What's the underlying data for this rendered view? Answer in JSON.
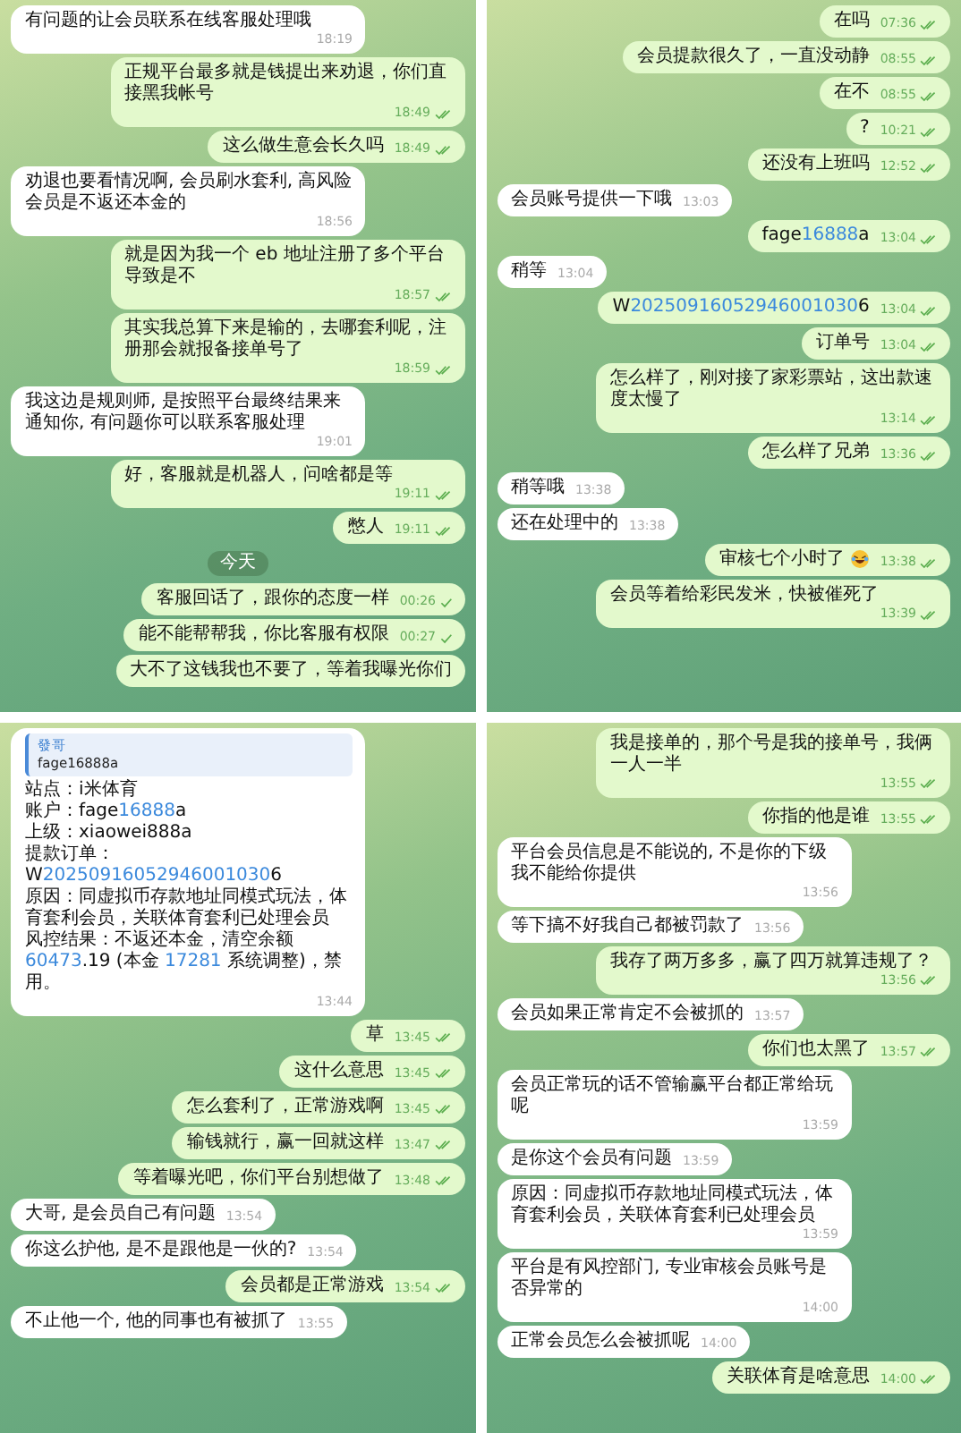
{
  "panels": [
    {
      "items": [
        {
          "kind": "in",
          "text": "有问题的让会员联系在线客服处理哦",
          "time": "18:19"
        },
        {
          "kind": "out",
          "text": "正规平台最多就是钱提出来劝退，你们直接黑我帐号",
          "time": "18:49",
          "read": true
        },
        {
          "kind": "out",
          "text": "这么做生意会长久吗",
          "time": "18:49",
          "read": true
        },
        {
          "kind": "in",
          "text": "劝退也要看情况啊, 会员刷水套利, 高风险会员是不返还本金的",
          "time": "18:56"
        },
        {
          "kind": "out",
          "text": "就是因为我一个 eb 地址注册了多个平台导致是不",
          "time": "18:57",
          "read": true
        },
        {
          "kind": "out",
          "text": "其实我总算下来是输的，去哪套利呢，注册那会就报备接单号了",
          "time": "18:59",
          "read": true
        },
        {
          "kind": "in",
          "text": "我这边是规则师, 是按照平台最终结果来通知你, 有问题你可以联系客服处理",
          "time": "19:01"
        },
        {
          "kind": "out",
          "text": "好，客服就是机器人，问啥都是等",
          "time": "19:11",
          "read": true
        },
        {
          "kind": "out",
          "text": "憋人",
          "time": "19:11",
          "read": true
        },
        {
          "kind": "date",
          "text": "今天"
        },
        {
          "kind": "out",
          "text": "客服回话了，跟你的态度一样",
          "time": "00:26",
          "read": false
        },
        {
          "kind": "out",
          "text": "能不能帮帮我，你比客服有权限",
          "time": "00:27",
          "read": false
        },
        {
          "kind": "out",
          "text": "大不了这钱我也不要了，等着我曝光你们"
        }
      ]
    },
    {
      "items": [
        {
          "kind": "out",
          "text": "在吗",
          "time": "07:36",
          "read": true
        },
        {
          "kind": "out",
          "text": "会员提款很久了，一直没动静",
          "time": "08:55",
          "read": true
        },
        {
          "kind": "out",
          "text": "在不",
          "time": "08:55",
          "read": true
        },
        {
          "kind": "out",
          "text": "?",
          "time": "10:21",
          "read": true
        },
        {
          "kind": "out",
          "text": "还没有上班吗",
          "time": "12:52",
          "read": true
        },
        {
          "kind": "in",
          "text": "会员账号提供一下哦",
          "time": "13:03"
        },
        {
          "kind": "out",
          "segments": [
            {
              "text": "fage"
            },
            {
              "text": "16888",
              "link": true
            },
            {
              "text": "a"
            }
          ],
          "time": "13:04",
          "read": true
        },
        {
          "kind": "in",
          "text": "稍等",
          "time": "13:04"
        },
        {
          "kind": "out",
          "segments": [
            {
              "text": "W"
            },
            {
              "text": "20250916052946001030",
              "link": true
            },
            {
              "text": "6"
            }
          ],
          "time": "13:04",
          "read": true
        },
        {
          "kind": "out",
          "text": "订单号",
          "time": "13:04",
          "read": true
        },
        {
          "kind": "out",
          "text": "怎么样了，刚对接了家彩票站，这出款速度太慢了",
          "time": "13:14",
          "read": true
        },
        {
          "kind": "out",
          "text": "怎么样了兄弟",
          "time": "13:36",
          "read": true
        },
        {
          "kind": "in",
          "text": "稍等哦",
          "time": "13:38"
        },
        {
          "kind": "in",
          "text": "还在处理中的",
          "time": "13:38"
        },
        {
          "kind": "out",
          "text": "审核七个小时了",
          "emoji": true,
          "time": "13:38",
          "read": true
        },
        {
          "kind": "out",
          "text": "会员等着给彩民发米，快被催死了",
          "time": "13:39",
          "read": true
        }
      ]
    },
    {
      "items": [
        {
          "kind": "in",
          "reply": {
            "author": "發哥",
            "text": "fage16888a"
          },
          "lines": [
            {
              "text": "站点：i米体育"
            },
            {
              "segments": [
                {
                  "text": "账户：fage"
                },
                {
                  "text": "16888",
                  "link": true
                },
                {
                  "text": "a"
                }
              ]
            },
            {
              "text": "上级：xiaowei888a"
            },
            {
              "text": "提款订单："
            },
            {
              "segments": [
                {
                  "text": "W"
                },
                {
                  "text": "20250916052946001030",
                  "link": true
                },
                {
                  "text": "6"
                }
              ]
            },
            {
              "text": "原因：同虚拟币存款地址同模式玩法，体育套利会员，关联体育套利已处理会员"
            },
            {
              "segments": [
                {
                  "text": "风控结果：不返还本金，清空余额"
                },
                {
                  "text": "60473",
                  "link": true
                },
                {
                  "text": ".19 (本金 "
                },
                {
                  "text": "17281",
                  "link": true
                },
                {
                  "text": " 系统调整)，禁用。"
                }
              ]
            }
          ],
          "time": "13:44"
        },
        {
          "kind": "out",
          "text": "草",
          "time": "13:45",
          "read": true
        },
        {
          "kind": "out",
          "text": "这什么意思",
          "time": "13:45",
          "read": true
        },
        {
          "kind": "out",
          "text": "怎么套利了，正常游戏啊",
          "time": "13:45",
          "read": true
        },
        {
          "kind": "out",
          "text": "输钱就行，赢一回就这样",
          "time": "13:47",
          "read": true
        },
        {
          "kind": "out",
          "text": "等着曝光吧，你们平台别想做了",
          "time": "13:48",
          "read": true
        },
        {
          "kind": "in",
          "text": "大哥, 是会员自己有问题",
          "time": "13:54"
        },
        {
          "kind": "in",
          "text": "你这么护他, 是不是跟他是一伙的?",
          "time": "13:54"
        },
        {
          "kind": "out",
          "text": "会员都是正常游戏",
          "time": "13:54",
          "read": true
        },
        {
          "kind": "in",
          "text": "不止他一个, 他的同事也有被抓了",
          "time": "13:55"
        }
      ]
    },
    {
      "items": [
        {
          "kind": "out",
          "text": "我是接单的，那个号是我的接单号，我俩一人一半",
          "time": "13:55",
          "read": true
        },
        {
          "kind": "out",
          "text": "你指的他是谁",
          "time": "13:55",
          "read": true
        },
        {
          "kind": "in",
          "text": "平台会员信息是不能说的, 不是你的下级我不能给你提供",
          "time": "13:56"
        },
        {
          "kind": "in",
          "text": "等下搞不好我自己都被罚款了",
          "time": "13:56"
        },
        {
          "kind": "out",
          "text": "我存了两万多多，赢了四万就算违规了？",
          "time": "13:56",
          "read": true
        },
        {
          "kind": "in",
          "text": "会员如果正常肯定不会被抓的",
          "time": "13:57"
        },
        {
          "kind": "out",
          "text": "你们也太黑了",
          "time": "13:57",
          "read": true
        },
        {
          "kind": "in",
          "text": "会员正常玩的话不管输赢平台都正常给玩呢",
          "time": "13:59"
        },
        {
          "kind": "in",
          "text": "是你这个会员有问题",
          "time": "13:59"
        },
        {
          "kind": "in",
          "text": "原因：同虚拟币存款地址同模式玩法，体育套利会员，关联体育套利已处理会员",
          "time": "13:59"
        },
        {
          "kind": "in",
          "text": "平台是有风控部门, 专业审核会员账号是否异常的",
          "time": "14:00"
        },
        {
          "kind": "in",
          "text": "正常会员怎么会被抓呢",
          "time": "14:00"
        },
        {
          "kind": "out",
          "text": "关联体育是啥意思",
          "time": "14:00",
          "read": true
        }
      ]
    }
  ]
}
